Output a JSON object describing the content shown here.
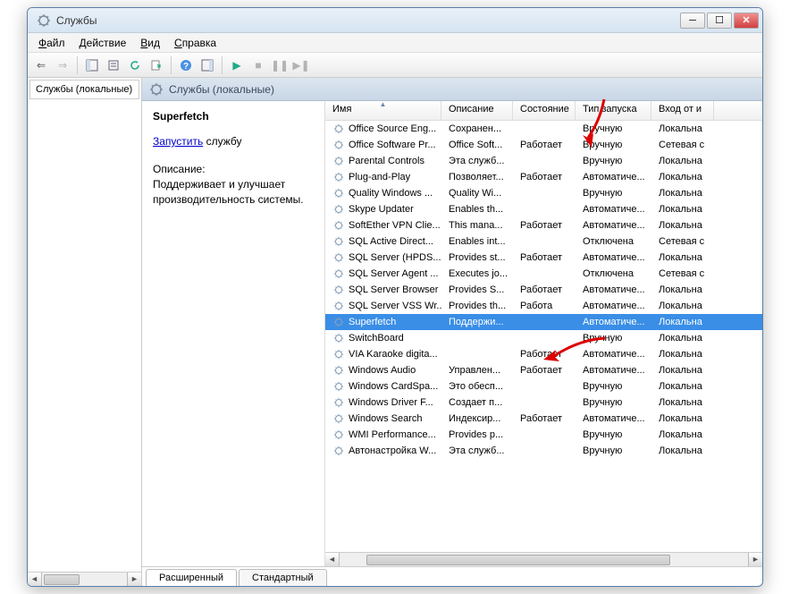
{
  "window": {
    "title": "Службы"
  },
  "menu": {
    "file": "Файл",
    "action": "Действие",
    "view": "Вид",
    "help": "Справка"
  },
  "left": {
    "header": "Службы (локальные)"
  },
  "rightHeader": "Службы (локальные)",
  "detail": {
    "name": "Superfetch",
    "startLink": "Запустить",
    "startSuffix": " службу",
    "descLabel": "Описание:",
    "descText": "Поддерживает и улучшает производительность системы."
  },
  "columns": {
    "name": "Имя",
    "desc": "Описание",
    "status": "Состояние",
    "startup": "Тип запуска",
    "logon": "Вход от и"
  },
  "tabs": {
    "ext": "Расширенный",
    "std": "Стандартный"
  },
  "services": [
    {
      "name": "Office  Source Eng...",
      "desc": "Сохранен...",
      "status": "",
      "startup": "Вручную",
      "logon": "Локальна"
    },
    {
      "name": "Office Software Pr...",
      "desc": "Office Soft...",
      "status": "Работает",
      "startup": "Вручную",
      "logon": "Сетевая с"
    },
    {
      "name": "Parental Controls",
      "desc": "Эта служб...",
      "status": "",
      "startup": "Вручную",
      "logon": "Локальна"
    },
    {
      "name": "Plug-and-Play",
      "desc": "Позволяет...",
      "status": "Работает",
      "startup": "Автоматиче...",
      "logon": "Локальна"
    },
    {
      "name": "Quality Windows ...",
      "desc": "Quality Wi...",
      "status": "",
      "startup": "Вручную",
      "logon": "Локальна"
    },
    {
      "name": "Skype Updater",
      "desc": "Enables th...",
      "status": "",
      "startup": "Автоматиче...",
      "logon": "Локальна"
    },
    {
      "name": "SoftEther VPN Clie...",
      "desc": "This mana...",
      "status": "Работает",
      "startup": "Автоматиче...",
      "logon": "Локальна"
    },
    {
      "name": "SQL Active Direct...",
      "desc": "Enables int...",
      "status": "",
      "startup": "Отключена",
      "logon": "Сетевая с"
    },
    {
      "name": "SQL Server (HPDS...",
      "desc": "Provides st...",
      "status": "Работает",
      "startup": "Автоматиче...",
      "logon": "Локальна"
    },
    {
      "name": "SQL Server Agent ...",
      "desc": "Executes jo...",
      "status": "",
      "startup": "Отключена",
      "logon": "Сетевая с"
    },
    {
      "name": "SQL Server Browser",
      "desc": "Provides S...",
      "status": "Работает",
      "startup": "Автоматиче...",
      "logon": "Локальна"
    },
    {
      "name": "SQL Server VSS Wr...",
      "desc": "Provides th...",
      "status": "Работа",
      "startup": "Автоматиче...",
      "logon": "Локальна"
    },
    {
      "name": "Superfetch",
      "desc": "Поддержи...",
      "status": "",
      "startup": "Автоматиче...",
      "logon": "Локальна",
      "selected": true
    },
    {
      "name": "SwitchBoard",
      "desc": "",
      "status": "",
      "startup": "Вручную",
      "logon": "Локальна"
    },
    {
      "name": "VIA Karaoke digita...",
      "desc": "",
      "status": "Работает",
      "startup": "Автоматиче...",
      "logon": "Локальна"
    },
    {
      "name": "Windows Audio",
      "desc": "Управлен...",
      "status": "Работает",
      "startup": "Автоматиче...",
      "logon": "Локальна"
    },
    {
      "name": "Windows CardSpa...",
      "desc": "Это обесп...",
      "status": "",
      "startup": "Вручную",
      "logon": "Локальна"
    },
    {
      "name": "Windows Driver F...",
      "desc": "Создает п...",
      "status": "",
      "startup": "Вручную",
      "logon": "Локальна"
    },
    {
      "name": "Windows Search",
      "desc": "Индексир...",
      "status": "Работает",
      "startup": "Автоматиче...",
      "logon": "Локальна"
    },
    {
      "name": "WMI Performance...",
      "desc": "Provides p...",
      "status": "",
      "startup": "Вручную",
      "logon": "Локальна"
    },
    {
      "name": "Автонастройка W...",
      "desc": "Эта служб...",
      "status": "",
      "startup": "Вручную",
      "logon": "Локальна"
    }
  ],
  "colWidths": {
    "name": 130,
    "desc": 80,
    "status": 70,
    "startup": 85,
    "logon": 70
  }
}
